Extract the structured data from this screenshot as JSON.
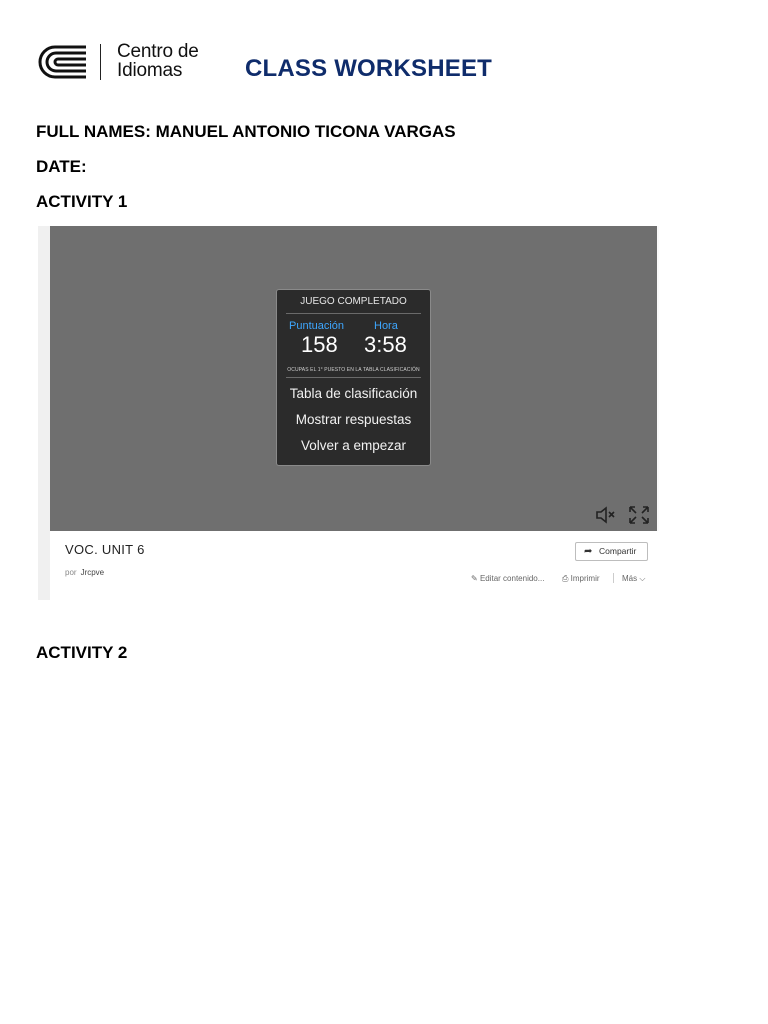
{
  "header": {
    "logo_line1": "Centro de",
    "logo_line2": "Idiomas",
    "title": "CLASS WORKSHEET",
    "brand_color": "#0f2c6b"
  },
  "fields": {
    "full_names": "FULL NAMES: MANUEL ANTONIO TICONA VARGAS",
    "date": "DATE:",
    "activity1": "ACTIVITY 1",
    "activity2": "ACTIVITY 2"
  },
  "screenshot": {
    "dialog": {
      "heading": "JUEGO COMPLETADO",
      "score_label": "Puntuación",
      "time_label": "Hora",
      "score_value": "158",
      "time_value": "3:58",
      "rank_text": "OCUPAS EL 1° PUESTO EN LA TABLA CLASIFICACIÓN",
      "options": [
        "Tabla de clasificación",
        "Mostrar respuestas",
        "Volver a empezar"
      ]
    },
    "icons": {
      "mute": "mute-icon",
      "fullscreen": "fullscreen-icon"
    },
    "info": {
      "activity_title": "VOC. UNIT 6",
      "by": "por",
      "author": "Jrcpve",
      "share_label": "Compartir",
      "edit_label": "Editar contenido...",
      "print_label": "Imprimir",
      "more_label": "Más"
    }
  }
}
